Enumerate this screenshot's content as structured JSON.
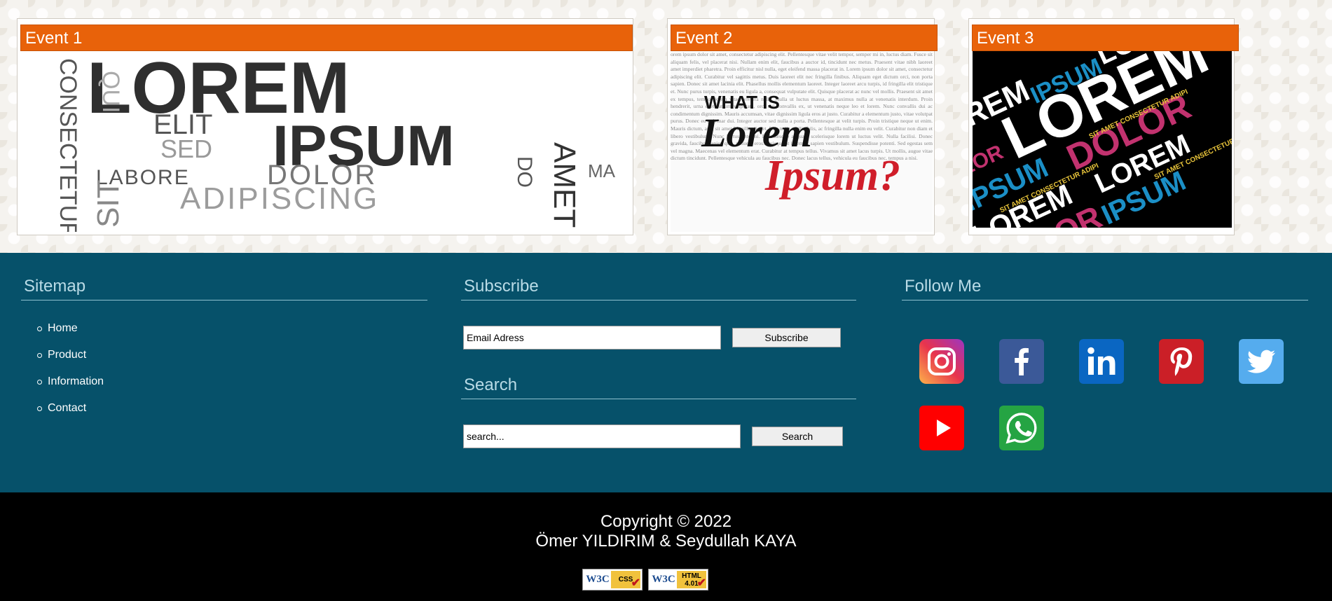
{
  "events": [
    {
      "title": "Event 1"
    },
    {
      "title": "Event 2"
    },
    {
      "title": "Event 3"
    }
  ],
  "event1_art": {
    "big": "LOREM",
    "ipsum": "IPSUM",
    "elit": "ELIT",
    "qui": "QUI",
    "sed": "SED",
    "consectetur": "CONSECTETUR",
    "labore": "LABORE",
    "dolor": "DOLOR",
    "do": "DO",
    "amet": "AMET",
    "ma": "MA",
    "sit": "SIT",
    "adipiscing": "ADIPISCING"
  },
  "event2_art": {
    "what_is": "WHAT IS",
    "lorem": "Lorem",
    "ipsum": "Ipsum?",
    "filler": "orem ipsum dolor sit amet, consectetur adipiscing elit. Pellentesque vitae velit tempor, semper mi in, luctus diam. Fusce sit aliquam felis, vel placerat nisi. Nullam enim elit, faucibus a auctor id, tincidunt nec metus. Praesent vitae nibh laoreet amet imperdiet pharetra. Proin efficitur nisl nulla, eget eleifend massa placerat in. Lorem ipsum dolor sit amet, consectetur adipiscing elit. Curabitur vel sagittis metus. Duis laoreet elit nec fringilla finibus. Aliquam eget dictum orci, non porta sapien. Donec sit amet lacinia elit. Phasellus mollis elementum laoreet. Integer laoreet arcu turpis, id fringilla elit tristique et. Nunc purus turpis, venenatis eu ligula a, consequat vulputate elit. Quisque placerat ac nunc vel mollis. Praesent sit amet ex tempus, tempor lorem vitae, viverra nulla. Nulla ut luctus massa, at maximus nulla at venenatis interdum. Proin hendrerit, urna eget rutrum vulputate, orci dui convallis ex, ut venenatis neque leo et lorem. Nunc convallis dui ac condimentum dignissim. Mauris accumsan, vitae dignissim ligula eros at justo. Curabitur a elementum justo, vitae volutpat purus. Donec eu pulvinar dui. Integer auctor sed nulla a porta. Pellentesque at velit turpis. Proin tristique neque ut enim. Mauris dictum, arcu sit amet fringilla aliquet, felis nulla mollis felis, ac fringilla nulla enim eu velit. Curabitur non diam et libero vestibulum. Nunc luctus ante mi. Pellentesque aliquam scelerisque lorem ut luctus velit. Nulla facilisi. Donec gravida, faucibus sapien quis, posuere eros. Quisque at lorem at sapien vestibulum. Suspendisse potenti. Sed egestas sem vel magna. Maecenas vel elementum erat. Curabitur at tempus tellus. Vivamus sit amet lacus turpis. Ut mollis, augue vitae dictum tincidunt. Pellentesque vehicula au faucibus nec. Donec lacus tellus, vehicula eu faucibus nec, tempus a nisi."
  },
  "event3_art": {
    "lorem": "LOREM",
    "ipsum": "IPSUM",
    "dolor": "DOLOR",
    "small": "SIT AMET CONSECTETUR ADIPI"
  },
  "sitemap": {
    "title": "Sitemap",
    "items": [
      {
        "label": "Home"
      },
      {
        "label": "Product"
      },
      {
        "label": "Information"
      },
      {
        "label": "Contact"
      }
    ]
  },
  "subscribe": {
    "title": "Subscribe",
    "email_value": "Email Adress",
    "button_label": "Subscribe"
  },
  "search": {
    "title": "Search",
    "input_value": "search...",
    "button_label": "Search"
  },
  "follow": {
    "title": "Follow Me",
    "icons": [
      {
        "name": "instagram-icon",
        "color": "#d6246e"
      },
      {
        "name": "facebook-icon",
        "color": "#3b5998"
      },
      {
        "name": "linkedin-icon",
        "color": "#0a66c2"
      },
      {
        "name": "pinterest-icon",
        "color": "#cb1f27"
      },
      {
        "name": "twitter-icon",
        "color": "#55acee"
      },
      {
        "name": "youtube-icon",
        "color": "#ff0000"
      },
      {
        "name": "whatsapp-icon",
        "color": "#25a443"
      }
    ]
  },
  "footer": {
    "copyright": "Copyright © 2022",
    "authors": "Ömer YILDIRIM & Seydullah KAYA",
    "badges": [
      {
        "w3c": "W3C",
        "label": "CSS",
        "mark": "✔"
      },
      {
        "w3c": "W3C",
        "label": "HTML 4.01",
        "mark": "✔"
      }
    ]
  }
}
